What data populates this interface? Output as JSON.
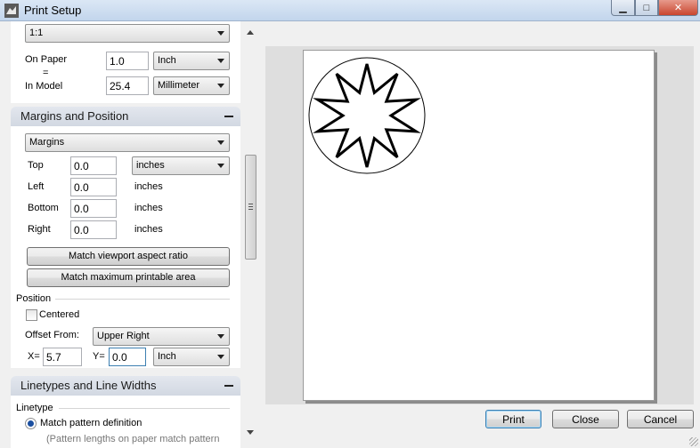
{
  "window": {
    "title": "Print Setup",
    "minimize_glyph": "▁",
    "maximize_glyph": "□",
    "close_glyph": "✕",
    "app_icon": "rhino-icon"
  },
  "scale": {
    "selected": "1:1",
    "on_paper_label": "On Paper",
    "equals": "=",
    "in_model_label": "In Model",
    "on_paper_value": "1.0",
    "on_paper_unit": "Inch",
    "in_model_value": "25.4",
    "in_model_unit": "Millimeter"
  },
  "margins": {
    "header": "Margins and Position",
    "mode": "Margins",
    "top_label": "Top",
    "top_value": "0.0",
    "units": "inches",
    "left_label": "Left",
    "left_value": "0.0",
    "left_units": "inches",
    "bottom_label": "Bottom",
    "bottom_value": "0.0",
    "bottom_units": "inches",
    "right_label": "Right",
    "right_value": "0.0",
    "right_units": "inches",
    "match_viewport_button": "Match viewport aspect ratio",
    "match_max_button": "Match maximum printable area"
  },
  "position": {
    "group_label": "Position",
    "centered_label": "Centered",
    "centered_checked": false,
    "offset_label": "Offset From:",
    "offset_value": "Upper Right",
    "x_label": "X=",
    "x_value": "5.7",
    "y_label": "Y=",
    "y_value": "0.0",
    "unit": "Inch"
  },
  "linetypes": {
    "header": "Linetypes and Line Widths",
    "group_label": "Linetype",
    "match_pattern_label": "Match pattern definition",
    "match_pattern_selected": true,
    "note": "(Pattern lengths on paper match pattern"
  },
  "buttons": {
    "print": "Print",
    "close": "Close",
    "cancel": "Cancel"
  }
}
